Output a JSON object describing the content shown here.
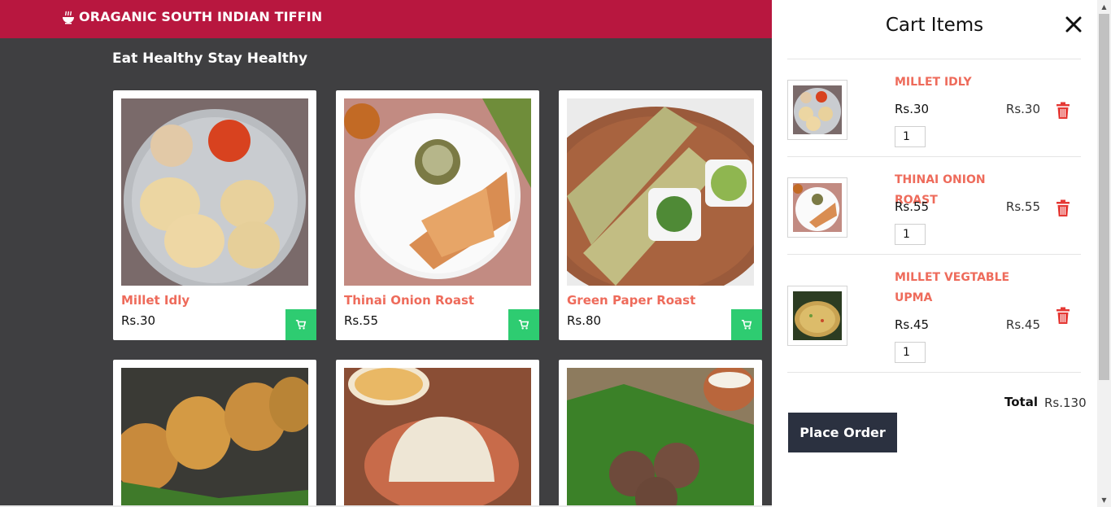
{
  "header": {
    "brand_icon": "bowl-icon",
    "brand_title": "ORAGANIC SOUTH INDIAN TIFFIN",
    "color": "#b8173f"
  },
  "tagline": "Eat Healthy Stay Healthy",
  "products": [
    {
      "name": "Millet Idly",
      "price": "Rs.30"
    },
    {
      "name": "Thinai Onion Roast",
      "price": "Rs.55"
    },
    {
      "name": "Green Paper Roast",
      "price": "Rs.80"
    },
    {
      "name": "",
      "price": ""
    },
    {
      "name": "",
      "price": ""
    },
    {
      "name": "",
      "price": ""
    }
  ],
  "cart": {
    "title": "Cart Items",
    "close_icon": "close-icon",
    "items": [
      {
        "name": "MILLET IDLY",
        "price": "Rs.30",
        "subtotal": "Rs.30",
        "qty": "1"
      },
      {
        "name": "THINAI ONION ROAST",
        "price": "Rs.55",
        "subtotal": "Rs.55",
        "qty": "1"
      },
      {
        "name": "MILLET VEGTABLE UPMA",
        "price": "Rs.45",
        "subtotal": "Rs.45",
        "qty": "1"
      }
    ],
    "total_label": "Total",
    "total_value": "Rs.130",
    "place_order": "Place Order"
  },
  "colors": {
    "accent": "#ee6b5b",
    "cart_button": "#2ecc71",
    "delete": "#e53935",
    "order_button": "#2b3140"
  }
}
